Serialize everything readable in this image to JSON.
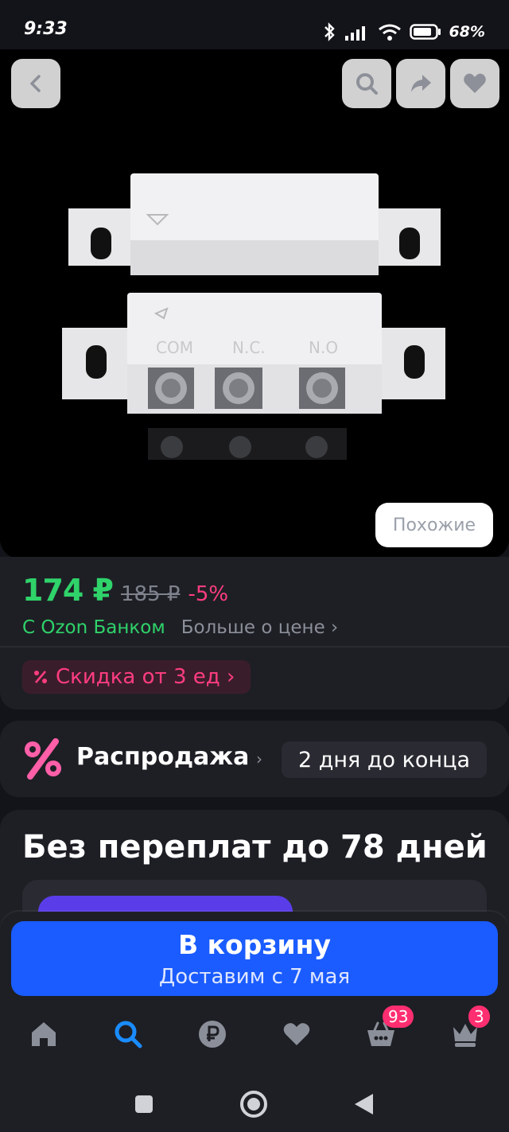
{
  "status_bar": {
    "time": "9:33",
    "battery": "68%",
    "icons": [
      "bluetooth-icon",
      "signal-icon",
      "wifi-icon",
      "battery-icon"
    ]
  },
  "hero": {
    "icons": {
      "back": "chevron-left-icon",
      "search": "search-icon",
      "share": "share-icon",
      "favorite": "heart-icon"
    },
    "similar_button": "Похожие"
  },
  "price": {
    "current": "174 ₽",
    "old": "185 ₽",
    "discount": "-5%",
    "bank_label": "С Ozon Банком",
    "more_link": "Больше о цене ›",
    "quantity_discount": "Скидка от 3 ед ›"
  },
  "sale": {
    "title": "Распродажа",
    "chevron": "›",
    "countdown": "2 дня до конца"
  },
  "installment": {
    "title": "Без переплат до 78 дней"
  },
  "cart": {
    "label": "В корзину",
    "delivery": "Доставим с 7 мая"
  },
  "tabbar": {
    "items": [
      {
        "icon": "home-icon",
        "active": false
      },
      {
        "icon": "search-icon",
        "active": true
      },
      {
        "icon": "ruble-icon",
        "active": false
      },
      {
        "icon": "heart-icon",
        "active": false
      },
      {
        "icon": "basket-icon",
        "active": false,
        "badge": "93"
      },
      {
        "icon": "crown-icon",
        "active": false,
        "badge": "3"
      }
    ]
  },
  "colors": {
    "accent_blue": "#1a5cff",
    "price_green": "#2fd36a",
    "discount_pink": "#ff3d7f",
    "badge_pink": "#ff2e70",
    "active_tab": "#1a8cff"
  }
}
